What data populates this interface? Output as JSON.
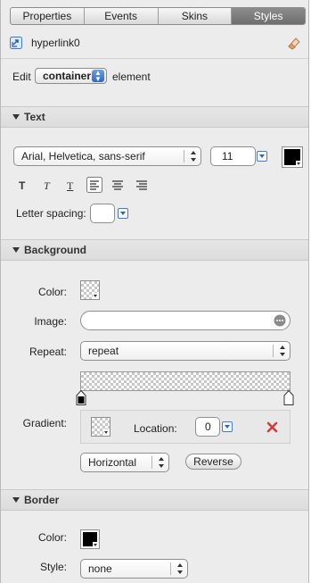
{
  "tabs": [
    "Properties",
    "Events",
    "Skins",
    "Styles"
  ],
  "active_tab": "Styles",
  "header": {
    "title": "hyperlink0"
  },
  "edit_row": {
    "prefix": "Edit",
    "selected": "container",
    "suffix": "element"
  },
  "text_section": {
    "title": "Text",
    "font_family": "Arial, Helvetica, sans-serif",
    "font_size": "11",
    "color": "#000000",
    "letter_spacing_label": "Letter spacing:",
    "letter_spacing_value": "",
    "format_buttons": [
      "T",
      "T",
      "T"
    ]
  },
  "background_section": {
    "title": "Background",
    "color_label": "Color:",
    "image_label": "Image:",
    "image_value": "",
    "repeat_label": "Repeat:",
    "repeat_value": "repeat",
    "gradient_label": "Gradient:",
    "location_label": "Location:",
    "location_value": "0",
    "direction_value": "Horizontal",
    "reverse_label": "Reverse"
  },
  "border_section": {
    "title": "Border",
    "color_label": "Color:",
    "color": "#000000",
    "style_label": "Style:",
    "style_value": "none"
  }
}
